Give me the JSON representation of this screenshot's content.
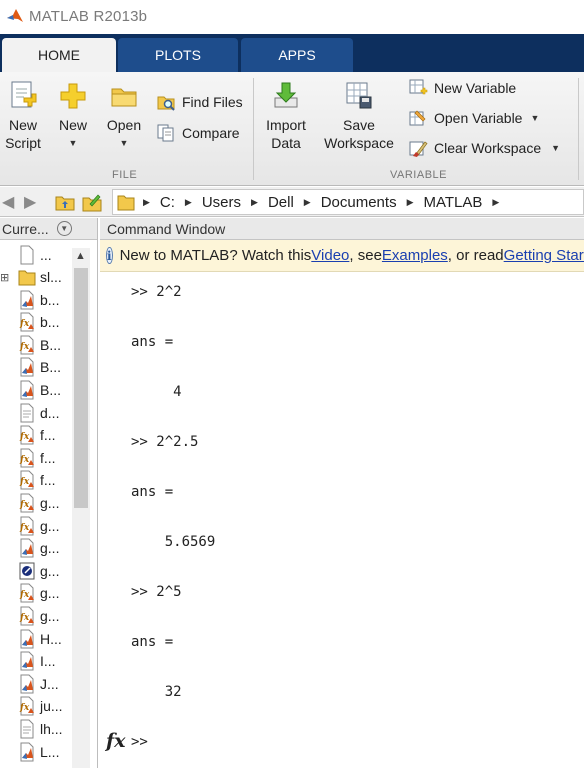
{
  "window": {
    "title": "MATLAB R2013b"
  },
  "tabs": [
    {
      "label": "HOME",
      "active": true
    },
    {
      "label": "PLOTS",
      "active": false
    },
    {
      "label": "APPS",
      "active": false
    }
  ],
  "ribbon": {
    "file": {
      "section_label": "FILE",
      "new_script": {
        "line1": "New",
        "line2": "Script"
      },
      "new": {
        "label": "New"
      },
      "open": {
        "label": "Open"
      },
      "find_files": "Find Files",
      "compare": "Compare"
    },
    "variable": {
      "section_label": "VARIABLE",
      "import_data": {
        "line1": "Import",
        "line2": "Data"
      },
      "save_workspace": {
        "line1": "Save",
        "line2": "Workspace"
      },
      "new_variable": "New Variable",
      "open_variable": "Open Variable",
      "clear_workspace": "Clear Workspace"
    }
  },
  "address": {
    "path": [
      "C:",
      "Users",
      "Dell",
      "Documents",
      "MATLAB"
    ]
  },
  "current_folder": {
    "title": "Curre...",
    "up_entry": "...",
    "items": [
      {
        "name": "sl...",
        "icon": "folder-icon"
      },
      {
        "name": "b...",
        "icon": "script-file-icon"
      },
      {
        "name": "b...",
        "icon": "function-file-icon"
      },
      {
        "name": "B...",
        "icon": "function-file-icon"
      },
      {
        "name": "B...",
        "icon": "script-file-icon"
      },
      {
        "name": "B...",
        "icon": "script-file-icon"
      },
      {
        "name": "d...",
        "icon": "text-file-icon"
      },
      {
        "name": "f...",
        "icon": "function-file-icon"
      },
      {
        "name": "f...",
        "icon": "function-file-icon"
      },
      {
        "name": "f...",
        "icon": "function-file-icon"
      },
      {
        "name": "g...",
        "icon": "function-file-icon"
      },
      {
        "name": "g...",
        "icon": "function-file-icon"
      },
      {
        "name": "g...",
        "icon": "script-file-icon"
      },
      {
        "name": "g...",
        "icon": "figure-file-icon"
      },
      {
        "name": "g...",
        "icon": "function-file-icon"
      },
      {
        "name": "g...",
        "icon": "function-file-icon"
      },
      {
        "name": "H...",
        "icon": "script-file-icon"
      },
      {
        "name": "I...",
        "icon": "script-file-icon"
      },
      {
        "name": "J...",
        "icon": "script-file-icon"
      },
      {
        "name": "ju...",
        "icon": "function-file-icon"
      },
      {
        "name": "lh...",
        "icon": "text-file-icon"
      },
      {
        "name": "L...",
        "icon": "script-file-icon"
      }
    ]
  },
  "command_window": {
    "title": "Command Window",
    "info": {
      "text1": "New to MATLAB? Watch this ",
      "link_video": "Video",
      "text2": ", see ",
      "link_examples": "Examples",
      "text3": ", or read ",
      "link_getting_started": "Getting Started"
    },
    "lines": [
      ">> 2^2",
      "ans =",
      "     4",
      ">> 2^2.5",
      "ans =",
      "    5.6569",
      ">> 2^5",
      "ans =",
      "    32"
    ],
    "prompt": ">>",
    "fx_label": "fx"
  }
}
